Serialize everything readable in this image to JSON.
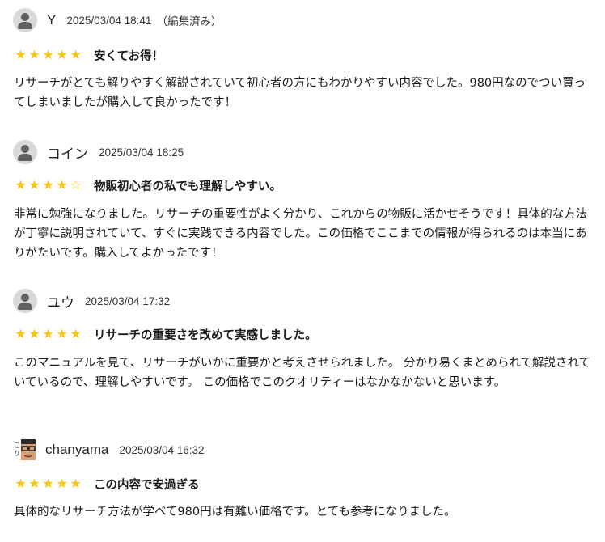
{
  "reviews": [
    {
      "username": "Y",
      "date": "2025/03/04 18:41",
      "edited": "（編集済み）",
      "rating": 5,
      "stars": [
        "★",
        "★",
        "★",
        "★",
        "★"
      ],
      "title": "安くてお得！",
      "body": "リサーチがとても解りやすく解説されていて初心者の方にもわかりやすい内容でした。980円なのでつい買ってしまいましたが購入して良かったです！",
      "avatar": "default-user-icon"
    },
    {
      "username": "コイン",
      "date": "2025/03/04 18:25",
      "edited": "",
      "rating": 4,
      "stars": [
        "★",
        "★",
        "★",
        "★",
        "☆"
      ],
      "title": "物販初心者の私でも理解しやすい。",
      "body": "非常に勉強になりました。リサーチの重要性がよく分かり、これからの物販に活かせそうです！具体的な方法が丁寧に説明されていて、すぐに実践できる内容でした。この価格でここまでの情報が得られるのは本当にありがたいです。購入してよかったです！",
      "avatar": "default-user-icon"
    },
    {
      "username": "ユウ",
      "date": "2025/03/04 17:32",
      "edited": "",
      "rating": 5,
      "stars": [
        "★",
        "★",
        "★",
        "★",
        "★"
      ],
      "title": "リサーチの重要さを改めて実感しました。",
      "body": "このマニュアルを見て、リサーチがいかに重要かと考えさせられました。 分かり易くまとめられて解説されていているので、理解しやすいです。 この価格でこのクオリティーはなかなかないと思います。",
      "avatar": "default-user-icon"
    },
    {
      "username": "chanyama",
      "date": "2025/03/04 16:32",
      "edited": "",
      "rating": 5,
      "stars": [
        "★",
        "★",
        "★",
        "★",
        "★"
      ],
      "title": "この内容で安過ぎる",
      "body": "具体的なリサーチ方法が学べて980円は有難い価格です。とても参考になりました。",
      "avatar": "photo-avatar"
    }
  ],
  "colors": {
    "star": "#f5c518",
    "avatar_bg": "#d9d9d9",
    "avatar_fg": "#5f5f5f",
    "text": "#1a1a1a"
  }
}
